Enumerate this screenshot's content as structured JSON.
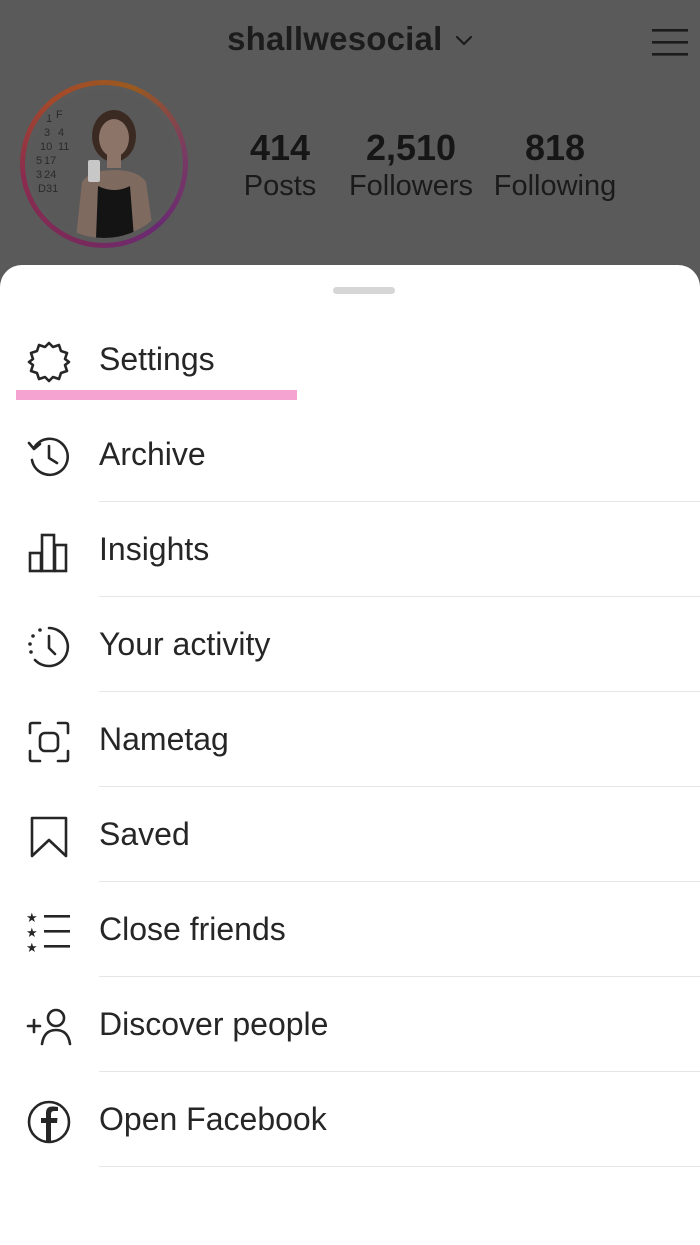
{
  "profile": {
    "username": "shallwesocial",
    "stats": [
      {
        "value": "414",
        "label": "Posts"
      },
      {
        "value": "2,510",
        "label": "Followers"
      },
      {
        "value": "818",
        "label": "Following"
      }
    ]
  },
  "menu": {
    "items": [
      {
        "label": "Settings",
        "icon": "settings-gear-icon"
      },
      {
        "label": "Archive",
        "icon": "archive-history-icon"
      },
      {
        "label": "Insights",
        "icon": "insights-bar-chart-icon"
      },
      {
        "label": "Your activity",
        "icon": "activity-clock-icon"
      },
      {
        "label": "Nametag",
        "icon": "nametag-scan-icon"
      },
      {
        "label": "Saved",
        "icon": "bookmark-icon"
      },
      {
        "label": "Close friends",
        "icon": "close-friends-list-icon"
      },
      {
        "label": "Discover people",
        "icon": "add-person-icon"
      },
      {
        "label": "Open Facebook",
        "icon": "facebook-icon"
      }
    ]
  },
  "colors": {
    "backdrop": "#5a5a5a",
    "highlight": "#f5a3d1",
    "text": "#262626"
  }
}
